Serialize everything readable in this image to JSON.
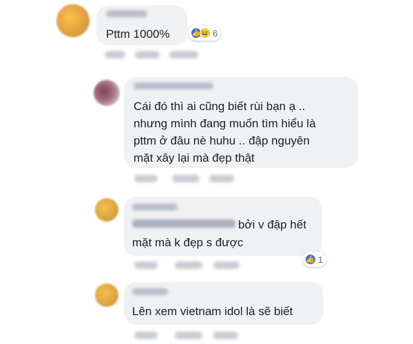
{
  "comments": [
    {
      "text": [
        "Pttm 1000%"
      ],
      "reactions": [
        "like-icon",
        "haha-icon"
      ],
      "reaction_count": "6"
    },
    {
      "text": [
        "Cái đó thì ai cũng biết rùi bạn ạ ..",
        "nhưng mình đang muốn tìm hiểu là",
        "pttm ở đâu nè huhu .. đập nguyên",
        "mặt xây lại mà đẹp thật"
      ]
    },
    {
      "text": [
        "bởi v đập hết",
        "mặt mà k đẹp s được"
      ],
      "reactions": [
        "like-icon"
      ],
      "reaction_count": "1"
    },
    {
      "text": [
        "Lên xem vietnam idol là sẽ biết"
      ]
    }
  ],
  "colors": {
    "bubble": "#eff1f3",
    "like": "#3b74d4",
    "haha": "#f5c842"
  }
}
